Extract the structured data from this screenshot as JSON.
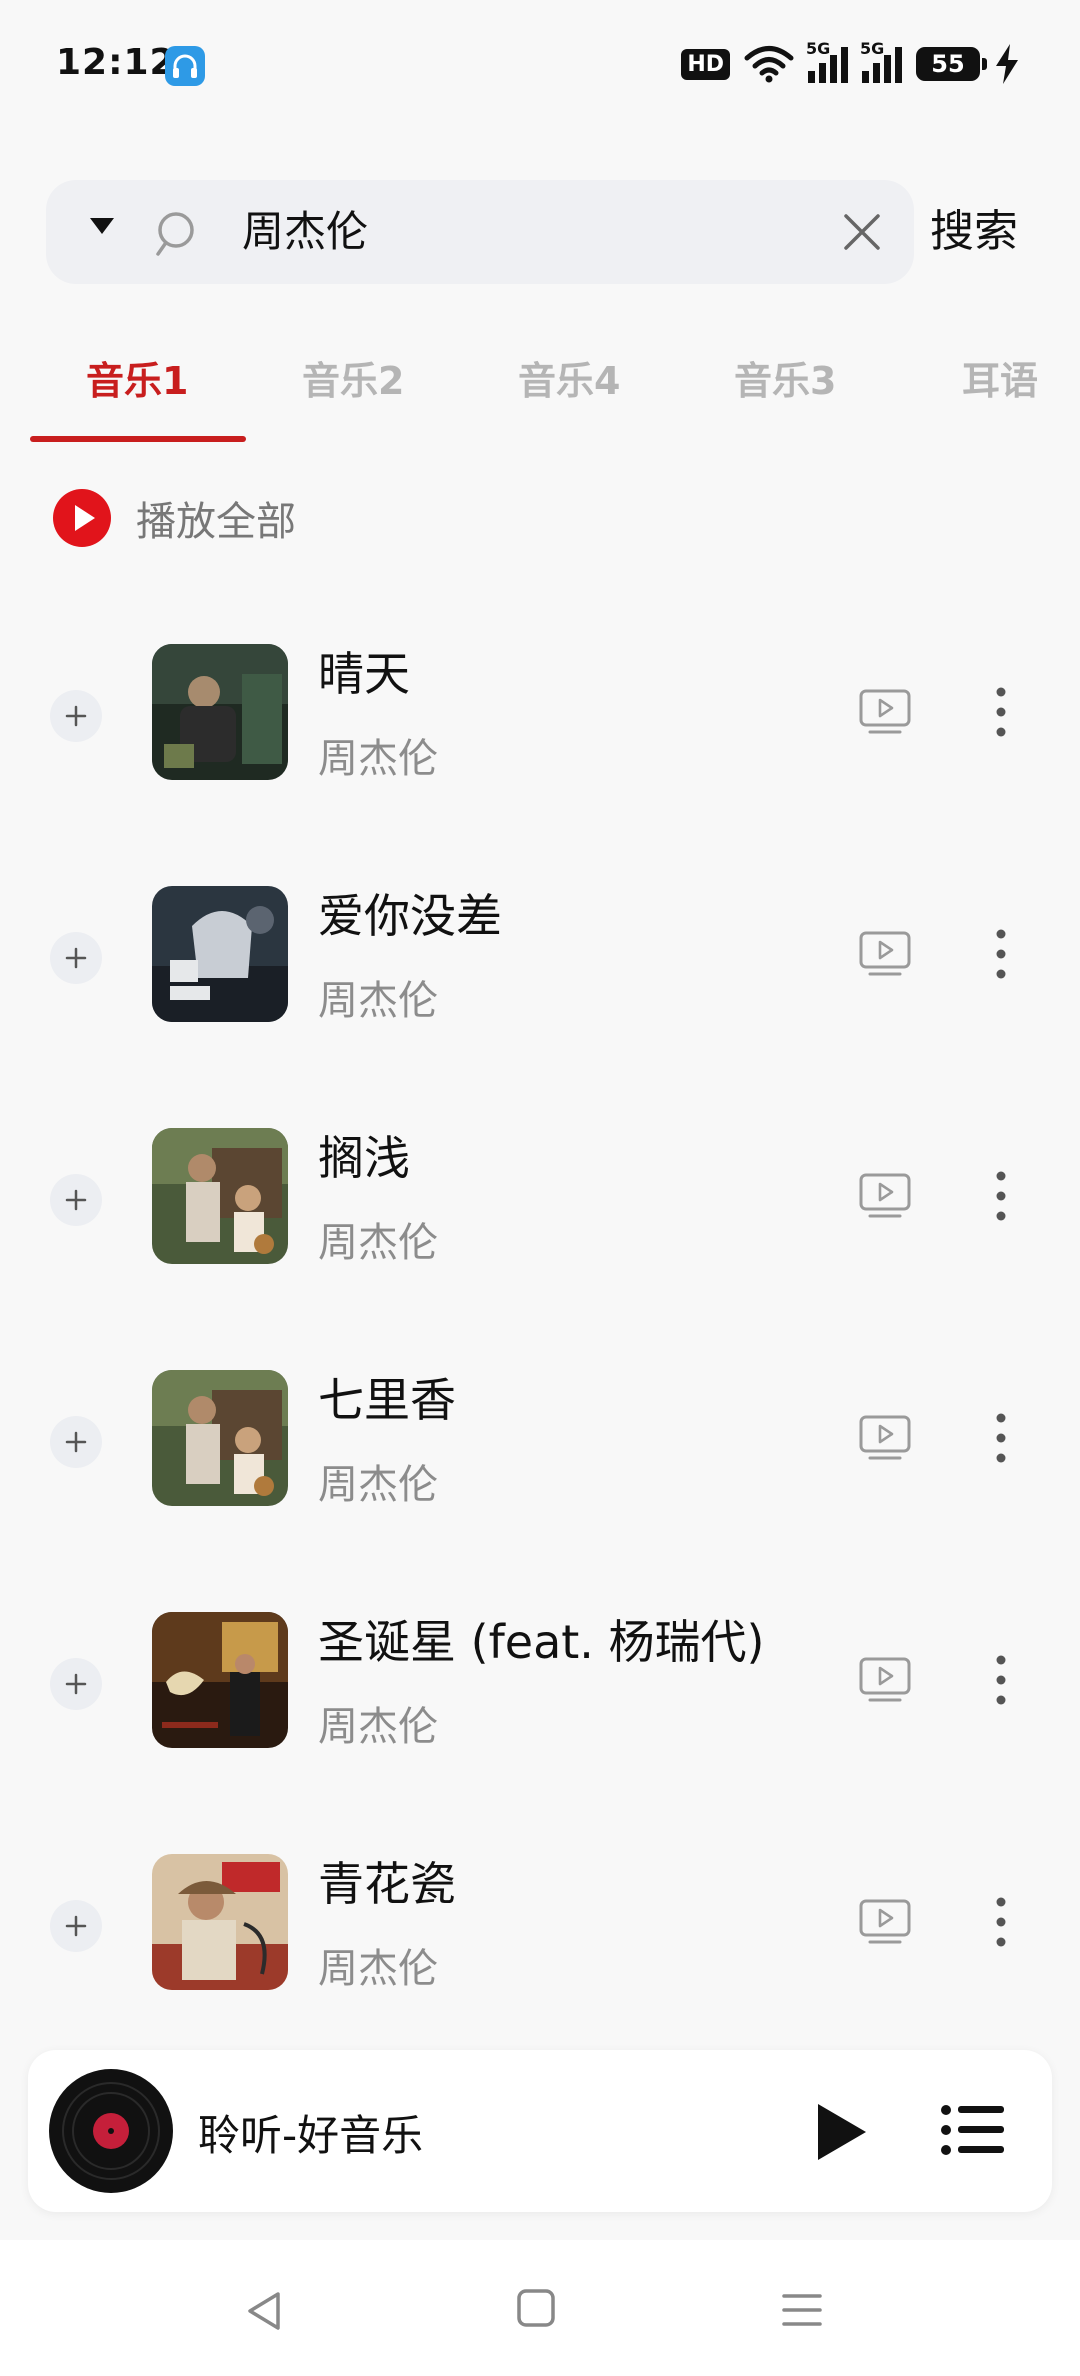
{
  "status_bar": {
    "time": "12:12",
    "hd": "HD",
    "network_1": "5G",
    "network_2": "5G",
    "battery": "55"
  },
  "search": {
    "query": "周杰伦",
    "submit_label": "搜索"
  },
  "tabs": [
    {
      "label": "音乐1",
      "active": true
    },
    {
      "label": "音乐2",
      "active": false
    },
    {
      "label": "音乐4",
      "active": false
    },
    {
      "label": "音乐3",
      "active": false
    },
    {
      "label": "耳语",
      "active": false
    }
  ],
  "play_all_label": "播放全部",
  "songs": [
    {
      "title": "晴天",
      "artist": "周杰伦",
      "cover": "album-cover-yehuimei"
    },
    {
      "title": "爱你没差",
      "artist": "周杰伦",
      "cover": "album-cover-jay-12"
    },
    {
      "title": "搁浅",
      "artist": "周杰伦",
      "cover": "album-cover-qilixiang"
    },
    {
      "title": "七里香",
      "artist": "周杰伦",
      "cover": "album-cover-qilixiang"
    },
    {
      "title": "圣诞星 (feat. 杨瑞代)",
      "artist": "周杰伦",
      "cover": "album-cover-christmas-star"
    },
    {
      "title": "青花瓷",
      "artist": "周杰伦",
      "cover": "album-cover-wo-hen-mang"
    }
  ],
  "mini_player": {
    "title": "聆听-好音乐"
  },
  "colors": {
    "accent": "#c81e1e",
    "tab_inactive": "#b5b5b5",
    "background": "#f8f8f8"
  }
}
